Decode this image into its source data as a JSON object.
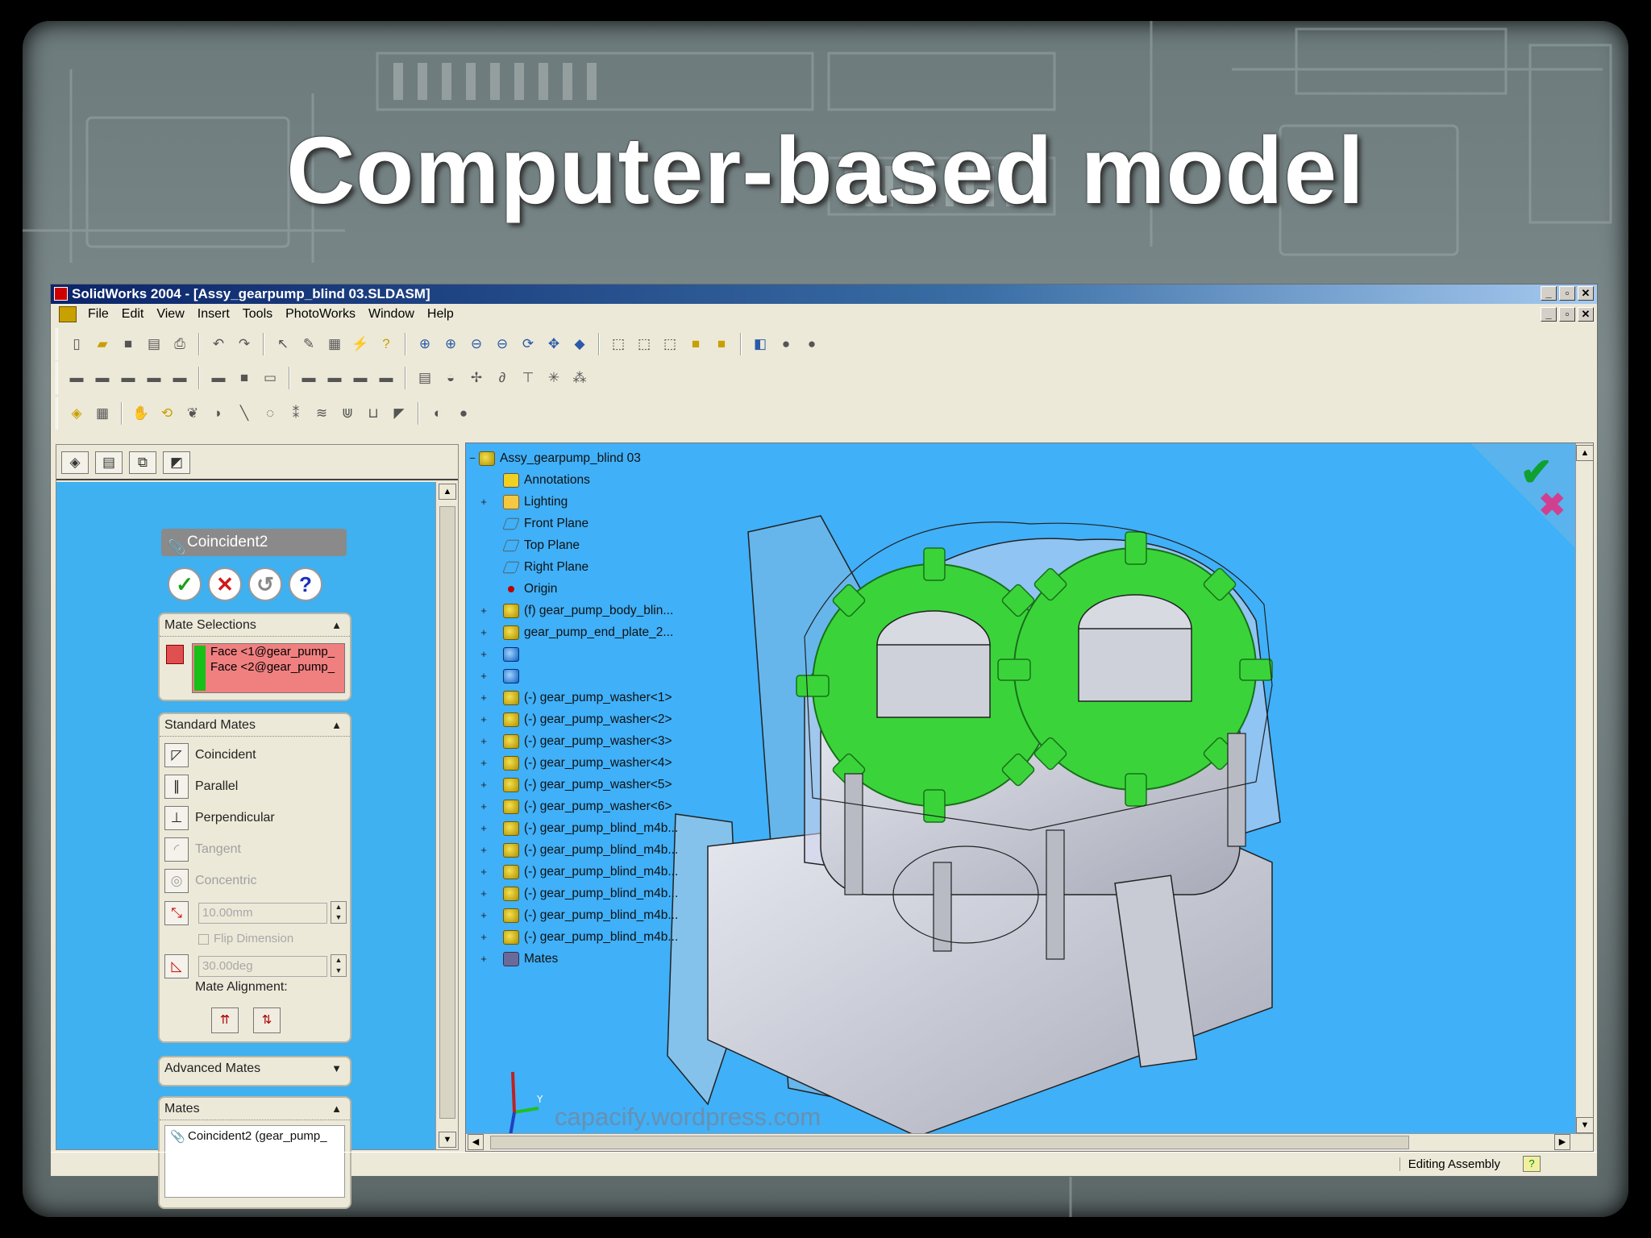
{
  "slide": {
    "title": "Computer-based model",
    "watermark": "capacify.wordpress.com"
  },
  "window": {
    "title": "SolidWorks 2004 - [Assy_gearpump_blind 03.SLDASM]",
    "menus": [
      "File",
      "Edit",
      "View",
      "Insert",
      "Tools",
      "PhotoWorks",
      "Window",
      "Help"
    ]
  },
  "property_manager": {
    "title": "Coincident2",
    "mate_selections": {
      "header": "Mate Selections",
      "items": [
        "Face <1@gear_pump_",
        "Face <2@gear_pump_"
      ]
    },
    "standard_mates": {
      "header": "Standard Mates",
      "items": [
        {
          "label": "Coincident",
          "enabled": true
        },
        {
          "label": "Parallel",
          "enabled": true
        },
        {
          "label": "Perpendicular",
          "enabled": true
        },
        {
          "label": "Tangent",
          "enabled": false
        },
        {
          "label": "Concentric",
          "enabled": false
        }
      ],
      "distance": "10.00mm",
      "flip_label": "Flip Dimension",
      "angle": "30.00deg",
      "alignment_label": "Mate Alignment:"
    },
    "advanced_mates": {
      "header": "Advanced Mates"
    },
    "mates": {
      "header": "Mates",
      "items": [
        "Coincident2 (gear_pump_"
      ]
    }
  },
  "tree": {
    "root": "Assy_gearpump_blind 03",
    "nodes": [
      {
        "label": "Annotations",
        "icon": "annotation-icon"
      },
      {
        "label": "Lighting",
        "icon": "lighting-icon"
      },
      {
        "label": "Front Plane",
        "icon": "plane-icon"
      },
      {
        "label": "Top Plane",
        "icon": "plane-icon"
      },
      {
        "label": "Right Plane",
        "icon": "plane-icon"
      },
      {
        "label": "Origin",
        "icon": "origin-icon"
      },
      {
        "label": "(f) gear_pump_body_blin...",
        "icon": "part-icon"
      },
      {
        "label": "gear_pump_end_plate_2...",
        "icon": "part-icon"
      },
      {
        "label": "",
        "icon": "part-selected-icon"
      },
      {
        "label": "",
        "icon": "part-selected-icon"
      },
      {
        "label": "(-) gear_pump_washer<1>",
        "icon": "part-icon"
      },
      {
        "label": "(-) gear_pump_washer<2>",
        "icon": "part-icon"
      },
      {
        "label": "(-) gear_pump_washer<3>",
        "icon": "part-icon"
      },
      {
        "label": "(-) gear_pump_washer<4>",
        "icon": "part-icon"
      },
      {
        "label": "(-) gear_pump_washer<5>",
        "icon": "part-icon"
      },
      {
        "label": "(-) gear_pump_washer<6>",
        "icon": "part-icon"
      },
      {
        "label": "(-) gear_pump_blind_m4b...",
        "icon": "part-icon"
      },
      {
        "label": "(-) gear_pump_blind_m4b...",
        "icon": "part-icon"
      },
      {
        "label": "(-) gear_pump_blind_m4b...",
        "icon": "part-icon"
      },
      {
        "label": "(-) gear_pump_blind_m4b...",
        "icon": "part-icon"
      },
      {
        "label": "(-) gear_pump_blind_m4b...",
        "icon": "part-icon"
      },
      {
        "label": "(-) gear_pump_blind_m4b...",
        "icon": "part-icon"
      },
      {
        "label": "Mates",
        "icon": "mates-icon"
      }
    ]
  },
  "status": {
    "text": "Editing Assembly"
  },
  "colors": {
    "viewport": "#40b0f8",
    "gear": "#3ad43a",
    "panel": "#3fb0f0"
  }
}
